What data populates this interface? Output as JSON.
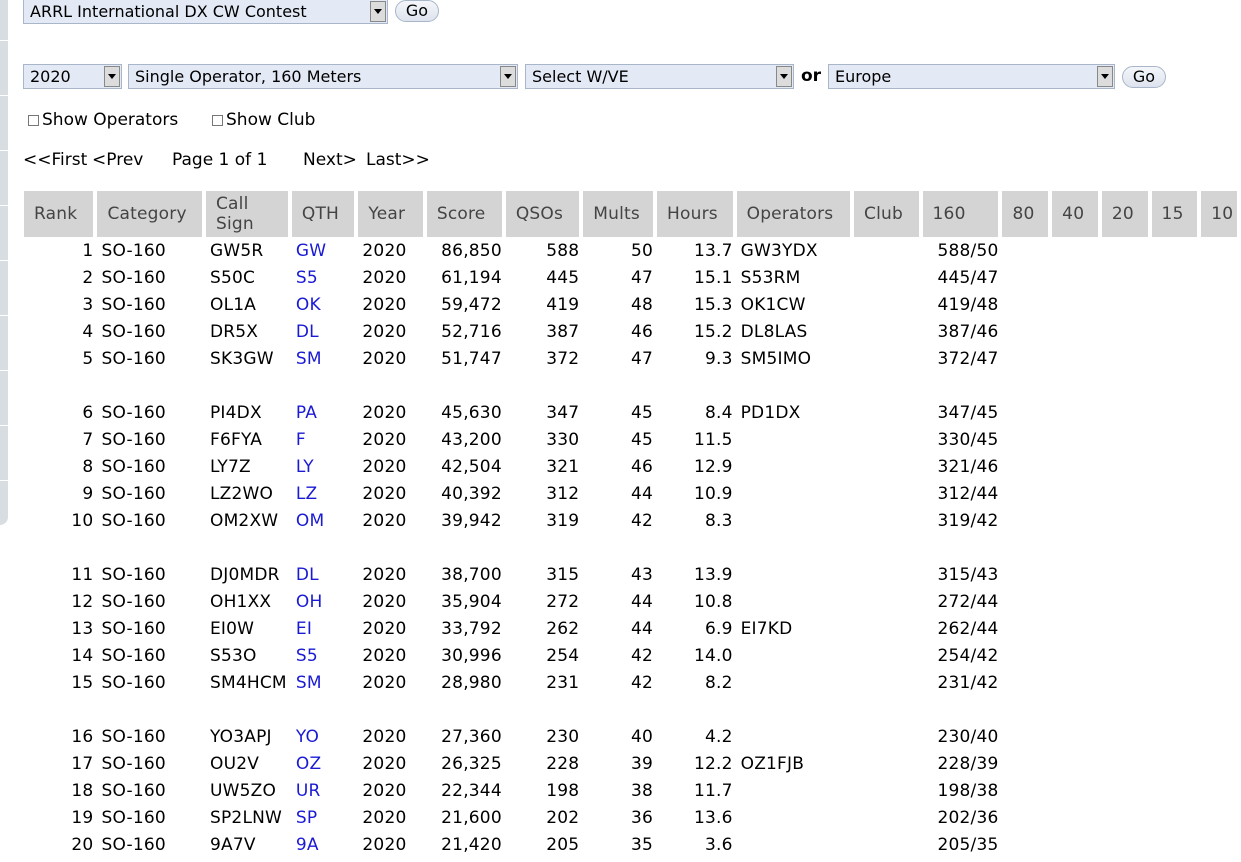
{
  "contest_select": {
    "value": "ARRL International DX CW Contest"
  },
  "go_label": "Go",
  "filters": {
    "year": "2020",
    "category": "Single Operator, 160 Meters",
    "wve": "Select W/VE",
    "or_label": "or",
    "region": "Europe"
  },
  "options": {
    "show_operators": "Show Operators",
    "show_club": "Show Club"
  },
  "pager": {
    "first": "<<First",
    "prev": "<Prev",
    "page": "Page 1 of 1",
    "next": "Next>",
    "last": "Last>>"
  },
  "columns": [
    "Rank",
    "Category",
    "Call Sign",
    "QTH",
    "Year",
    "Score",
    "QSOs",
    "Mults",
    "Hours",
    "Operators",
    "Club",
    "160",
    "80",
    "40",
    "20",
    "15",
    "10"
  ],
  "rows": [
    {
      "rank": "1",
      "category": "SO-160",
      "call": "GW5R",
      "qth": "GW",
      "year": "2020",
      "score": "86,850",
      "qsos": "588",
      "mults": "50",
      "hours": "13.7",
      "operators": "GW3YDX",
      "club": "",
      "b160": "588/50"
    },
    {
      "rank": "2",
      "category": "SO-160",
      "call": "S50C",
      "qth": "S5",
      "year": "2020",
      "score": "61,194",
      "qsos": "445",
      "mults": "47",
      "hours": "15.1",
      "operators": "S53RM",
      "club": "",
      "b160": "445/47"
    },
    {
      "rank": "3",
      "category": "SO-160",
      "call": "OL1A",
      "qth": "OK",
      "year": "2020",
      "score": "59,472",
      "qsos": "419",
      "mults": "48",
      "hours": "15.3",
      "operators": "OK1CW",
      "club": "",
      "b160": "419/48"
    },
    {
      "rank": "4",
      "category": "SO-160",
      "call": "DR5X",
      "qth": "DL",
      "year": "2020",
      "score": "52,716",
      "qsos": "387",
      "mults": "46",
      "hours": "15.2",
      "operators": "DL8LAS",
      "club": "",
      "b160": "387/46"
    },
    {
      "rank": "5",
      "category": "SO-160",
      "call": "SK3GW",
      "qth": "SM",
      "year": "2020",
      "score": "51,747",
      "qsos": "372",
      "mults": "47",
      "hours": "9.3",
      "operators": "SM5IMO",
      "club": "",
      "b160": "372/47"
    },
    {
      "rank": "6",
      "category": "SO-160",
      "call": "PI4DX",
      "qth": "PA",
      "year": "2020",
      "score": "45,630",
      "qsos": "347",
      "mults": "45",
      "hours": "8.4",
      "operators": "PD1DX",
      "club": "",
      "b160": "347/45"
    },
    {
      "rank": "7",
      "category": "SO-160",
      "call": "F6FYA",
      "qth": "F",
      "year": "2020",
      "score": "43,200",
      "qsos": "330",
      "mults": "45",
      "hours": "11.5",
      "operators": "",
      "club": "",
      "b160": "330/45"
    },
    {
      "rank": "8",
      "category": "SO-160",
      "call": "LY7Z",
      "qth": "LY",
      "year": "2020",
      "score": "42,504",
      "qsos": "321",
      "mults": "46",
      "hours": "12.9",
      "operators": "",
      "club": "",
      "b160": "321/46"
    },
    {
      "rank": "9",
      "category": "SO-160",
      "call": "LZ2WO",
      "qth": "LZ",
      "year": "2020",
      "score": "40,392",
      "qsos": "312",
      "mults": "44",
      "hours": "10.9",
      "operators": "",
      "club": "",
      "b160": "312/44"
    },
    {
      "rank": "10",
      "category": "SO-160",
      "call": "OM2XW",
      "qth": "OM",
      "year": "2020",
      "score": "39,942",
      "qsos": "319",
      "mults": "42",
      "hours": "8.3",
      "operators": "",
      "club": "",
      "b160": "319/42"
    },
    {
      "rank": "11",
      "category": "SO-160",
      "call": "DJ0MDR",
      "qth": "DL",
      "year": "2020",
      "score": "38,700",
      "qsos": "315",
      "mults": "43",
      "hours": "13.9",
      "operators": "",
      "club": "",
      "b160": "315/43"
    },
    {
      "rank": "12",
      "category": "SO-160",
      "call": "OH1XX",
      "qth": "OH",
      "year": "2020",
      "score": "35,904",
      "qsos": "272",
      "mults": "44",
      "hours": "10.8",
      "operators": "",
      "club": "",
      "b160": "272/44"
    },
    {
      "rank": "13",
      "category": "SO-160",
      "call": "EI0W",
      "qth": "EI",
      "year": "2020",
      "score": "33,792",
      "qsos": "262",
      "mults": "44",
      "hours": "6.9",
      "operators": "EI7KD",
      "club": "",
      "b160": "262/44"
    },
    {
      "rank": "14",
      "category": "SO-160",
      "call": "S53O",
      "qth": "S5",
      "year": "2020",
      "score": "30,996",
      "qsos": "254",
      "mults": "42",
      "hours": "14.0",
      "operators": "",
      "club": "",
      "b160": "254/42"
    },
    {
      "rank": "15",
      "category": "SO-160",
      "call": "SM4HCM",
      "qth": "SM",
      "year": "2020",
      "score": "28,980",
      "qsos": "231",
      "mults": "42",
      "hours": "8.2",
      "operators": "",
      "club": "",
      "b160": "231/42"
    },
    {
      "rank": "16",
      "category": "SO-160",
      "call": "YO3APJ",
      "qth": "YO",
      "year": "2020",
      "score": "27,360",
      "qsos": "230",
      "mults": "40",
      "hours": "4.2",
      "operators": "",
      "club": "",
      "b160": "230/40"
    },
    {
      "rank": "17",
      "category": "SO-160",
      "call": "OU2V",
      "qth": "OZ",
      "year": "2020",
      "score": "26,325",
      "qsos": "228",
      "mults": "39",
      "hours": "12.2",
      "operators": "OZ1FJB",
      "club": "",
      "b160": "228/39"
    },
    {
      "rank": "18",
      "category": "SO-160",
      "call": "UW5ZO",
      "qth": "UR",
      "year": "2020",
      "score": "22,344",
      "qsos": "198",
      "mults": "38",
      "hours": "11.7",
      "operators": "",
      "club": "",
      "b160": "198/38"
    },
    {
      "rank": "19",
      "category": "SO-160",
      "call": "SP2LNW",
      "qth": "SP",
      "year": "2020",
      "score": "21,600",
      "qsos": "202",
      "mults": "36",
      "hours": "13.6",
      "operators": "",
      "club": "",
      "b160": "202/36"
    },
    {
      "rank": "20",
      "category": "SO-160",
      "call": "9A7V",
      "qth": "9A",
      "year": "2020",
      "score": "21,420",
      "qsos": "205",
      "mults": "35",
      "hours": "3.6",
      "operators": "",
      "club": "",
      "b160": "205/35"
    }
  ]
}
